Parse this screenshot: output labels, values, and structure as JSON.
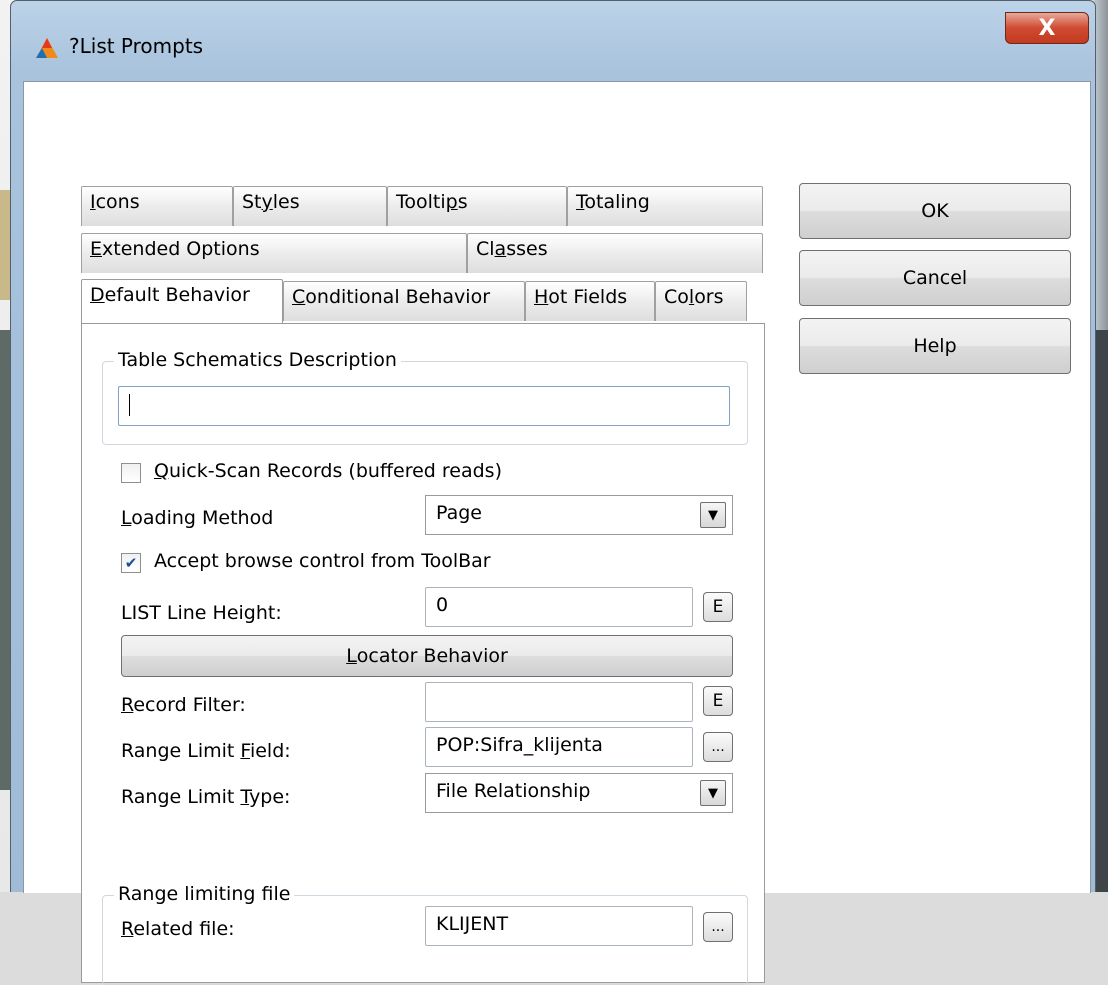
{
  "window": {
    "title": "?List Prompts",
    "close_glyph": "X"
  },
  "tabs": {
    "row1": [
      "Icons",
      "Styles",
      "Tooltips",
      "Totaling"
    ],
    "row2": [
      "Extended Options",
      "Classes"
    ],
    "row3": [
      "Default Behavior",
      "Conditional Behavior",
      "Hot Fields",
      "Colors"
    ],
    "active": "Default Behavior"
  },
  "schematics": {
    "legend": "Table Schematics Description",
    "value": ""
  },
  "quick_scan": {
    "label": "Quick-Scan Records (buffered reads)",
    "checked": false
  },
  "loading_method": {
    "label": "Loading Method",
    "value": "Page"
  },
  "accept_browse": {
    "label": "Accept browse control from ToolBar",
    "checked": true
  },
  "line_height": {
    "label": "LIST Line Height:",
    "value": "0",
    "button": "E"
  },
  "locator_button": "Locator Behavior",
  "record_filter": {
    "label": "Record Filter:",
    "value": "",
    "button": "E"
  },
  "range_field": {
    "label": "Range Limit Field:",
    "value": "POP:Sifra_klijenta",
    "button": "..."
  },
  "range_type": {
    "label": "Range Limit Type:",
    "value": "File Relationship"
  },
  "range_file": {
    "legend": "Range limiting file",
    "label": "Related file:",
    "value": "KLIJENT",
    "button": "..."
  },
  "buttons": {
    "ok": "OK",
    "cancel": "Cancel",
    "help": "Help"
  },
  "colors": {
    "check_mark": "#1a4fa0",
    "close_button": "#cf4b31",
    "title_bar": "#a9c3dd"
  }
}
